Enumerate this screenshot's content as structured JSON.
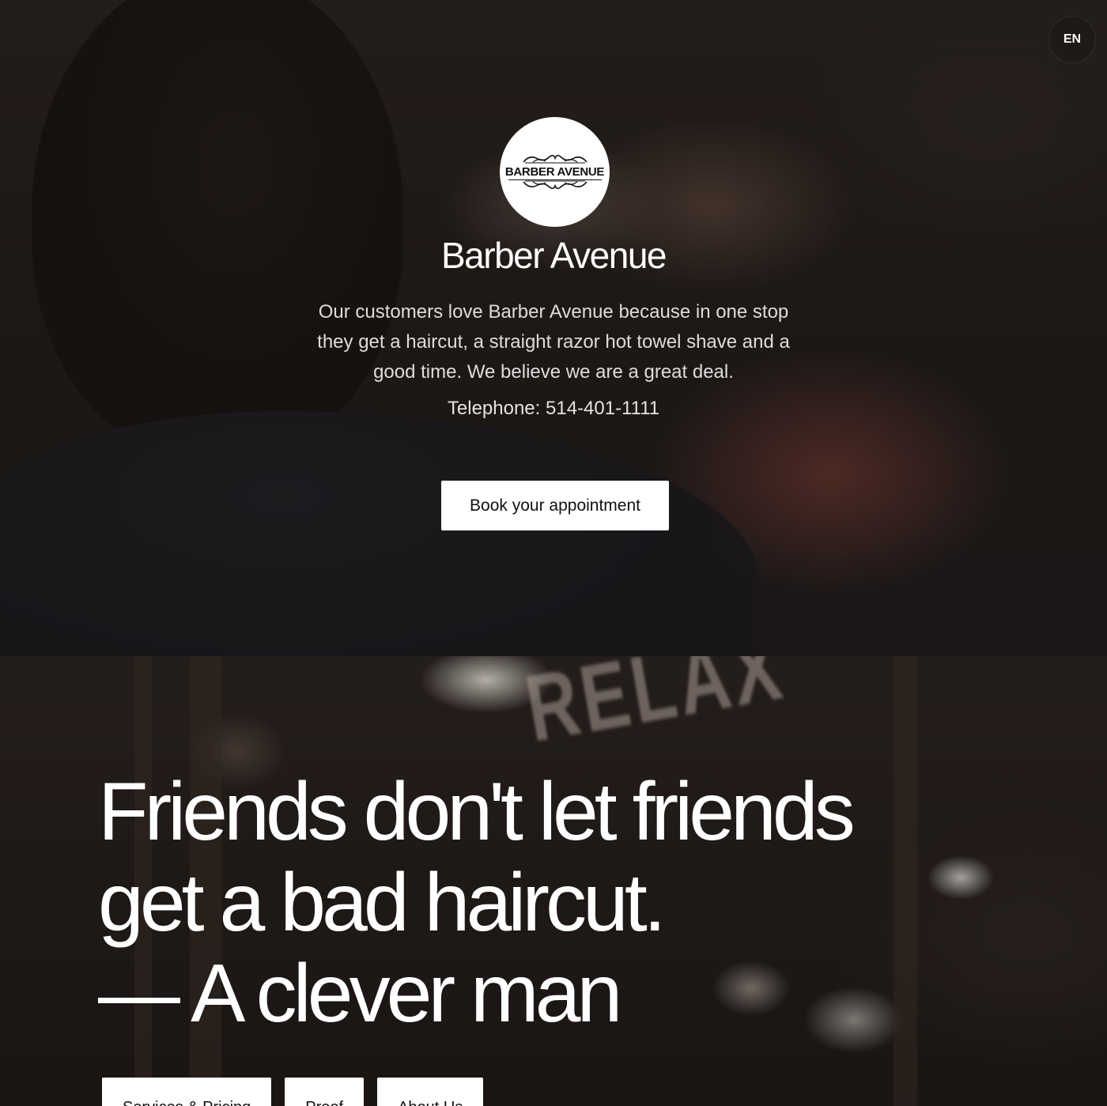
{
  "language": {
    "label": "EN"
  },
  "hero": {
    "logo_text": "BARBER AVENUE",
    "title": "Barber Avenue",
    "tagline": "Our customers love Barber Avenue because in one stop they get a haircut, a straight razor hot towel shave and a good time. We believe we are a great deal.",
    "telephone": "Telephone: 514-401-1111",
    "book_label": "Book your appointment"
  },
  "quote_section": {
    "sign_text": "RELAX",
    "quote_lines": [
      "Friends don't let friends",
      "get a bad haircut.",
      "— A clever man"
    ],
    "nav": [
      {
        "label": "Services & Pricing"
      },
      {
        "label": "Proof"
      },
      {
        "label": "About Us"
      }
    ]
  },
  "colors": {
    "button_bg": "#ffffff",
    "button_text": "#111111",
    "hero_text": "#ffffff"
  }
}
